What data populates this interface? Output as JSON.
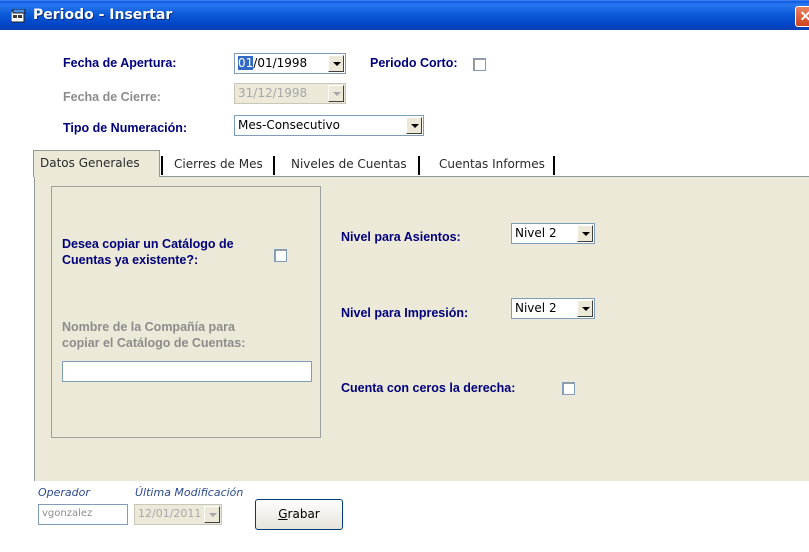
{
  "window": {
    "title": "Periodo - Insertar",
    "close_glyph": "✕"
  },
  "header": {
    "fecha_apertura_label": "Fecha de Apertura:",
    "fecha_apertura_sel": "01",
    "fecha_apertura_rest": "/01/1998",
    "periodo_corto_label": "Periodo Corto:",
    "fecha_cierre_label": "Fecha de Cierre:",
    "fecha_cierre_value": "31/12/1998",
    "tipo_numeracion_label": "Tipo de Numeración:",
    "tipo_numeracion_value": "Mes-Consecutivo"
  },
  "tabs": [
    {
      "label": "Datos Generales",
      "active": true
    },
    {
      "label": "Cierres de Mes",
      "active": false
    },
    {
      "label": "Niveles de Cuentas",
      "active": false
    },
    {
      "label": "Cuentas Informes",
      "active": false
    }
  ],
  "datos_generales": {
    "copiar_catalogo_label_1": "Desea copiar un Catálogo de",
    "copiar_catalogo_label_2": "Cuentas ya existente?:",
    "nombre_compania_label_1": "Nombre de la Compañía para",
    "nombre_compania_label_2": "copiar el Catálogo de Cuentas:",
    "nombre_compania_value": "",
    "nivel_asientos_label": "Nivel para Asientos:",
    "nivel_asientos_value": "Nivel 2",
    "nivel_impresion_label": "Nivel para Impresión:",
    "nivel_impresion_value": "Nivel 2",
    "ceros_derecha_label": "Cuenta con ceros la derecha:"
  },
  "footer": {
    "operador_label": "Operador",
    "operador_value": "vgonzalez",
    "ultima_mod_label": "Última Modificación",
    "ultima_mod_value": "12/01/2011",
    "grabar_underlined": "G",
    "grabar_rest": "rabar"
  },
  "colors": {
    "titlebar": "#0b5ad8",
    "label": "#00007b",
    "panel": "#ece9d8",
    "selection": "#316ac5"
  }
}
